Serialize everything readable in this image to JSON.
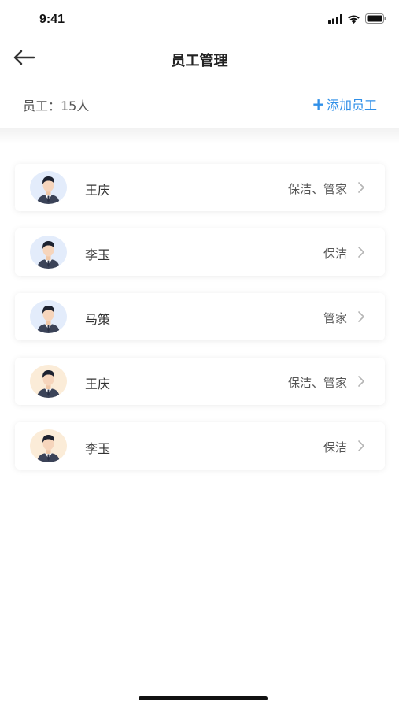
{
  "status_bar": {
    "time": "9:41",
    "icons": [
      "cellular-signal-icon",
      "wifi-icon",
      "battery-icon"
    ]
  },
  "nav": {
    "title": "员工管理",
    "back_icon": "arrow-left-icon"
  },
  "summary": {
    "count_label": "员工：15人",
    "add_plus": "+",
    "add_label": "添加员工"
  },
  "colors": {
    "accent": "#2f8fe8",
    "avatar_blue_bg": "#e3ecfb",
    "avatar_beige_bg": "#fbecd8"
  },
  "employees": [
    {
      "name": "王庆",
      "role": "保洁、管家",
      "avatar_bg": "blue"
    },
    {
      "name": "李玉",
      "role": "保洁",
      "avatar_bg": "blue"
    },
    {
      "name": "马策",
      "role": "管家",
      "avatar_bg": "blue"
    },
    {
      "name": "王庆",
      "role": "保洁、管家",
      "avatar_bg": "beige"
    },
    {
      "name": "李玉",
      "role": "保洁",
      "avatar_bg": "beige"
    }
  ]
}
